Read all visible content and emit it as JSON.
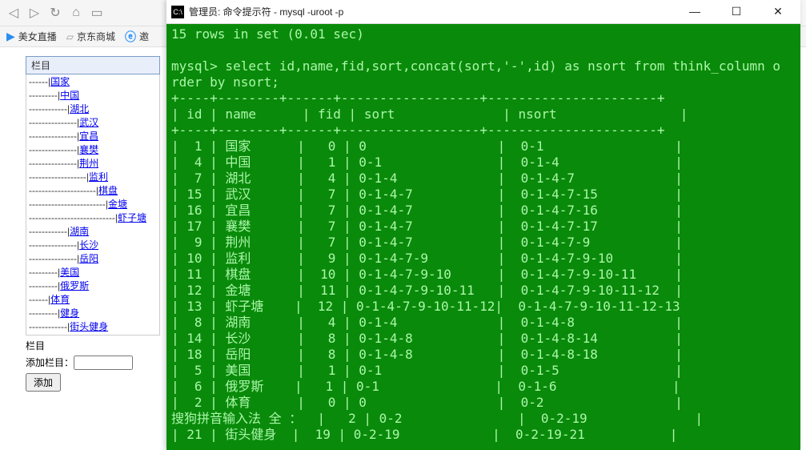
{
  "browser": {
    "back": "◁",
    "fwd": "▷",
    "reload": "↻",
    "home": "⌂",
    "book": "▭"
  },
  "bookmarks": {
    "a": "美女直播",
    "b": "京东商城",
    "c": "邀"
  },
  "panel": {
    "title": "栏目",
    "items": [
      {
        "pad": "------",
        "txt": "国家"
      },
      {
        "pad": "---------",
        "txt": "中国"
      },
      {
        "pad": "------------",
        "txt": "湖北"
      },
      {
        "pad": "---------------",
        "txt": "武汉"
      },
      {
        "pad": "---------------",
        "txt": "宜昌"
      },
      {
        "pad": "---------------",
        "txt": "襄樊"
      },
      {
        "pad": "---------------",
        "txt": "荆州"
      },
      {
        "pad": "------------------",
        "txt": "监利"
      },
      {
        "pad": "---------------------",
        "txt": "棋盘"
      },
      {
        "pad": "------------------------",
        "txt": "金塘"
      },
      {
        "pad": "---------------------------",
        "txt": "虾子塘"
      },
      {
        "pad": "------------",
        "txt": "湖南"
      },
      {
        "pad": "---------------",
        "txt": "长沙"
      },
      {
        "pad": "---------------",
        "txt": "岳阳"
      },
      {
        "pad": "---------",
        "txt": "美国"
      },
      {
        "pad": "---------",
        "txt": "俄罗斯"
      },
      {
        "pad": "------",
        "txt": "体育"
      },
      {
        "pad": "---------",
        "txt": "健身"
      },
      {
        "pad": "------------",
        "txt": "街头健身"
      }
    ],
    "label_col": "栏目",
    "label_add": "添加栏目：",
    "btn_add": "添加"
  },
  "term": {
    "title": "管理员: 命令提示符 - mysql  -uroot -p",
    "min": "—",
    "max": "☐",
    "close": "✕",
    "line1": "15 rows in set (0.01 sec)",
    "line2": "",
    "line3": "mysql> select id,name,fid,sort,concat(sort,'-',id) as nsort from think_column o",
    "line4": "rder by nsort;",
    "hr_top": "+----+--------+------+------------------+----------------------+",
    "hdr": "| id | name      | fid | sort              | nsort                |",
    "hr_mid": "+----+--------+------+------------------+----------------------+",
    "rows": [
      "|  1 | 国家      |   0 | 0                 |  0-1                 |",
      "|  4 | 中国      |   1 | 0-1               |  0-1-4               |",
      "|  7 | 湖北      |   4 | 0-1-4             |  0-1-4-7             |",
      "| 15 | 武汉      |   7 | 0-1-4-7           |  0-1-4-7-15          |",
      "| 16 | 宜昌      |   7 | 0-1-4-7           |  0-1-4-7-16          |",
      "| 17 | 襄樊      |   7 | 0-1-4-7           |  0-1-4-7-17          |",
      "|  9 | 荆州      |   7 | 0-1-4-7           |  0-1-4-7-9           |",
      "| 10 | 监利      |   9 | 0-1-4-7-9         |  0-1-4-7-9-10        |",
      "| 11 | 棋盘      |  10 | 0-1-4-7-9-10      |  0-1-4-7-9-10-11     |",
      "| 12 | 金塘      |  11 | 0-1-4-7-9-10-11   |  0-1-4-7-9-10-11-12  |",
      "| 13 | 虾子塘    |  12 | 0-1-4-7-9-10-11-12|  0-1-4-7-9-10-11-12-13",
      "|  8 | 湖南      |   4 | 0-1-4             |  0-1-4-8             |",
      "| 14 | 长沙      |   8 | 0-1-4-8           |  0-1-4-8-14          |",
      "| 18 | 岳阳      |   8 | 0-1-4-8           |  0-1-4-8-18          |",
      "|  5 | 美国      |   1 | 0-1               |  0-1-5               |",
      "|  6 | 俄罗斯    |   1 | 0-1               |  0-1-6               |",
      "|  2 | 体育      |   0 | 0                 |  0-2                 |",
      "搜狗拼音输入法 全 ：  |   2 | 0-2               |  0-2-19              |",
      "| 21 | 街头健身  |  19 | 0-2-19            |  0-2-19-21           |"
    ]
  }
}
